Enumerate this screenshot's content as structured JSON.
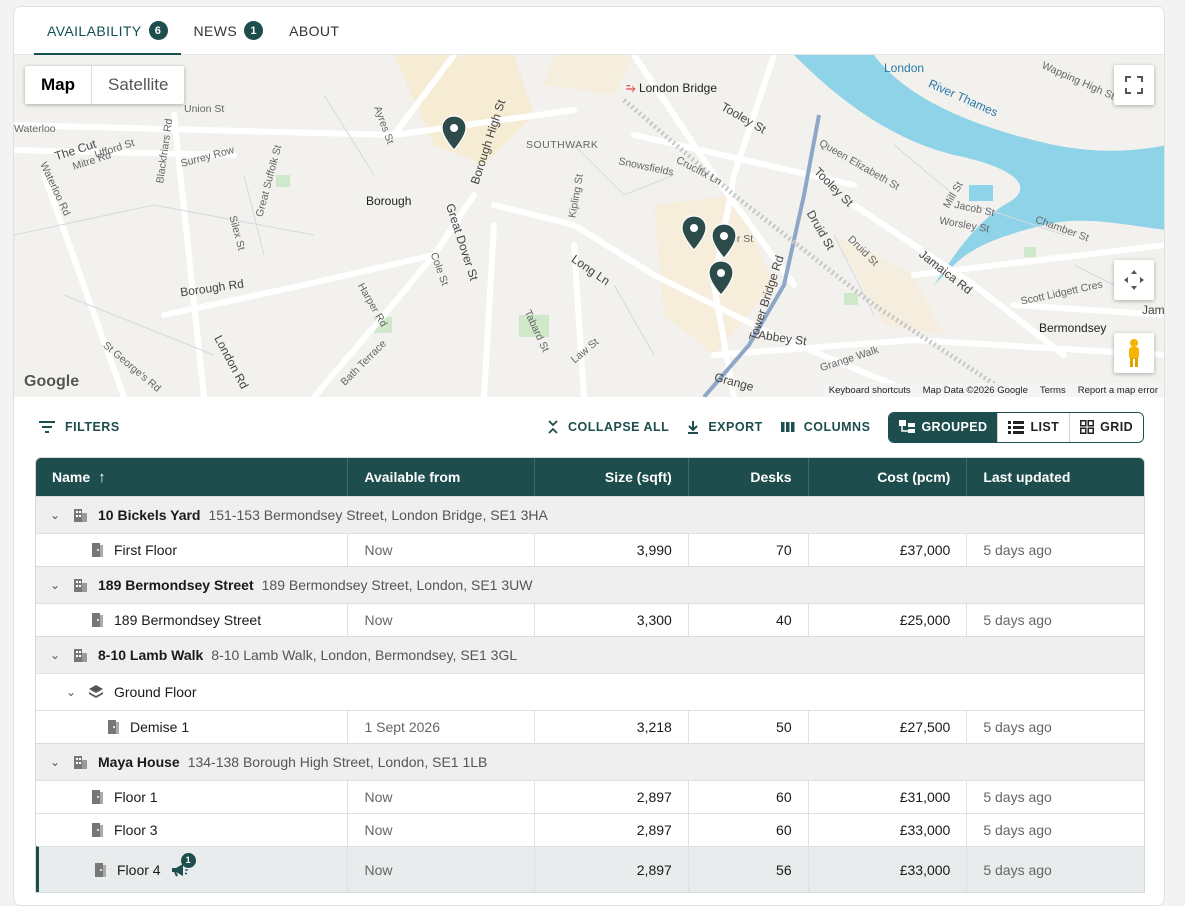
{
  "tabs": [
    {
      "label": "AVAILABILITY",
      "badge": "6"
    },
    {
      "label": "NEWS",
      "badge": "1"
    },
    {
      "label": "ABOUT"
    }
  ],
  "map": {
    "map_type": {
      "map": "Map",
      "satellite": "Satellite"
    },
    "labels": {
      "london_bridge": "London Bridge",
      "london": "London",
      "river": "River Thames",
      "southwark": "SOUTHWARK",
      "borough": "Borough",
      "bermondsey": "Bermondsey",
      "waterloo": "Waterloo",
      "the_cut": "The Cut",
      "union_st": "Union St",
      "tooley_st": "Tooley St",
      "tooley_st2": "Tooley St",
      "borough_high_st": "Borough High St",
      "great_dover_st": "Great Dover St",
      "borough_rd": "Borough Rd",
      "long_ln": "Long Ln",
      "abbey_st": "Abbey St",
      "druid_st": "Druid St",
      "jamaica_rd": "Jamaica Rd",
      "tower_bridge_rd": "Tower Bridge Rd",
      "london_rd": "London Rd",
      "grange_walk": "Grange Walk",
      "crucifix_ln": "Crucifix Ln",
      "snowsfields": "Snowsfields",
      "queen_elizabeth_st": "Queen Elizabeth St",
      "blackfriars_rd": "Blackfriars Rd",
      "surrey_row": "Surrey Row",
      "great_suffolk_st": "Great Suffolk St",
      "mitre_rd": "Mitre Rd",
      "ufford_st": "Ufford St",
      "waterloo_rd": "Waterloo Rd",
      "wapping_high_st": "Wapping High St",
      "chamber_st": "Chamber St",
      "jacob_st": "Jacob St",
      "scott_lidgett_cres": "Scott Lidgett Cres",
      "kipling_st": "Kipling St",
      "law_st": "Law St",
      "tabard_st": "Tabard St",
      "harper_rd": "Harper Rd",
      "cole_st": "Cole St",
      "bath_terrace": "Bath Terrace",
      "silex_st": "Silex St",
      "ayres_st": "Ayres St",
      "st_georges_rd": "St George's Rd",
      "grange": "Grange",
      "mill_st": "Mill St",
      "worsley_st": "Worsley St",
      "jam": "Jam",
      "er_st": "er St",
      "druid_st2": "Druid St"
    },
    "footer": {
      "shortcuts": "Keyboard shortcuts",
      "data": "Map Data ©2026 Google",
      "terms": "Terms",
      "report": "Report a map error"
    },
    "logo": "Google"
  },
  "toolbar": {
    "filters": "FILTERS",
    "collapse_all": "COLLAPSE ALL",
    "export": "EXPORT",
    "columns": "COLUMNS",
    "views": {
      "grouped": "GROUPED",
      "list": "LIST",
      "grid": "GRID"
    }
  },
  "table": {
    "headers": {
      "name": "Name",
      "available": "Available from",
      "size": "Size (sqft)",
      "desks": "Desks",
      "cost": "Cost (pcm)",
      "updated": "Last updated"
    },
    "groups": [
      {
        "name": "10 Bickels Yard",
        "address": "151-153 Bermondsey Street, London Bridge, SE1 3HA",
        "rows": [
          {
            "name": "First Floor",
            "available": "Now",
            "size": "3,990",
            "desks": "70",
            "cost": "£37,000",
            "updated": "5 days ago"
          }
        ]
      },
      {
        "name": "189 Bermondsey Street",
        "address": "189 Bermondsey Street, London, SE1 3UW",
        "rows": [
          {
            "name": "189 Bermondsey Street",
            "available": "Now",
            "size": "3,300",
            "desks": "40",
            "cost": "£25,000",
            "updated": "5 days ago"
          }
        ]
      },
      {
        "name": "8-10 Lamb Walk",
        "address": "8-10 Lamb Walk, London, Bermondsey, SE1 3GL",
        "subgroup": "Ground Floor",
        "rows": [
          {
            "name": "Demise 1",
            "available": "1 Sept 2026",
            "size": "3,218",
            "desks": "50",
            "cost": "£27,500",
            "updated": "5 days ago"
          }
        ]
      },
      {
        "name": "Maya House",
        "address": "134-138 Borough High Street, London, SE1 1LB",
        "rows": [
          {
            "name": "Floor 1",
            "available": "Now",
            "size": "2,897",
            "desks": "60",
            "cost": "£31,000",
            "updated": "5 days ago"
          },
          {
            "name": "Floor 3",
            "available": "Now",
            "size": "2,897",
            "desks": "60",
            "cost": "£33,000",
            "updated": "5 days ago"
          },
          {
            "name": "Floor 4",
            "available": "Now",
            "size": "2,897",
            "desks": "56",
            "cost": "£33,000",
            "updated": "5 days ago",
            "announcement_count": "1"
          }
        ]
      }
    ]
  }
}
